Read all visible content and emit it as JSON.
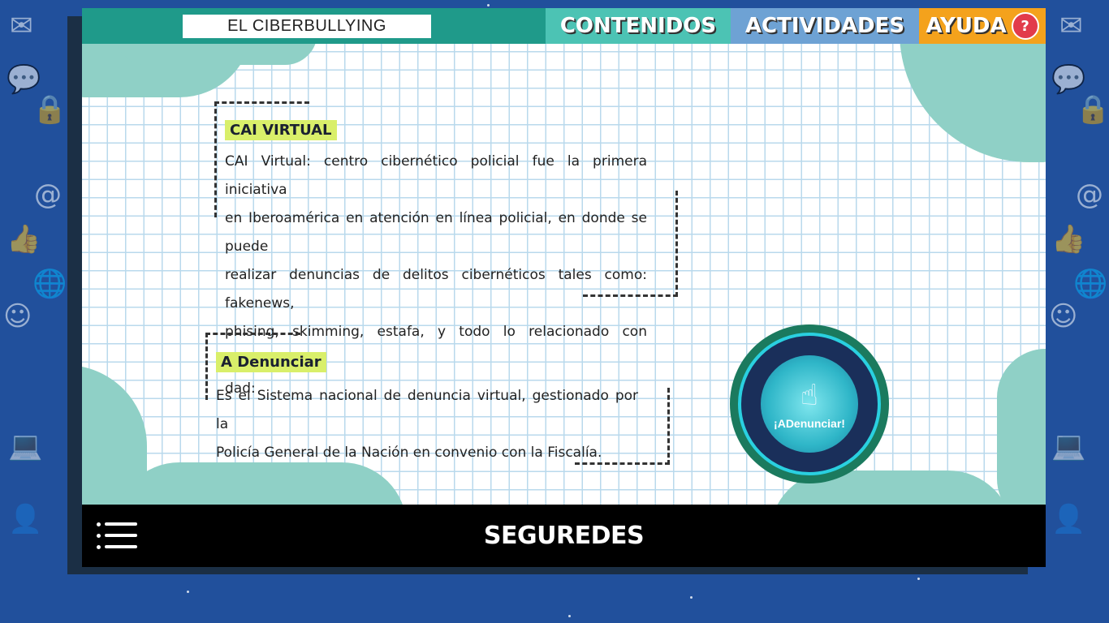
{
  "header": {
    "title": "EL CIBERBULLYING",
    "tabs": {
      "contenidos": "CONTENIDOS",
      "actividades": "ACTIVIDADES",
      "ayuda": "AYUDA",
      "ayuda_icon": "?"
    }
  },
  "sections": [
    {
      "heading": "CAI VIRTUAL",
      "lines": [
        "CAI Virtual: centro cibernético policial fue la primera iniciativa",
        "en Iberoamérica en atención en línea policial, en donde se puede",
        "realizar denuncias de delitos cibernéticos tales como: fakenews,",
        "phising, skimming, estafa, y todo lo relacionado con cibersegu­ri-",
        "dad:"
      ]
    },
    {
      "heading": "A Denunciar",
      "lines": [
        "Es el Sistema nacional de denuncia virtual, gestionado por la",
        "Policía General de la Nación en convenio con la Fiscalía."
      ]
    }
  ],
  "badge": {
    "label": "¡ADenunciar!",
    "icon": "hand-pointer-icon"
  },
  "footer": {
    "brand": "SEGUREDES"
  },
  "colors": {
    "topbar_teal": "#1f9a8a",
    "contenidos": "#4cc3b4",
    "actividades": "#6ea2d4",
    "ayuda": "#f4a21c",
    "heading_highlight": "#d9ef6a",
    "background_blue": "#21509c"
  }
}
